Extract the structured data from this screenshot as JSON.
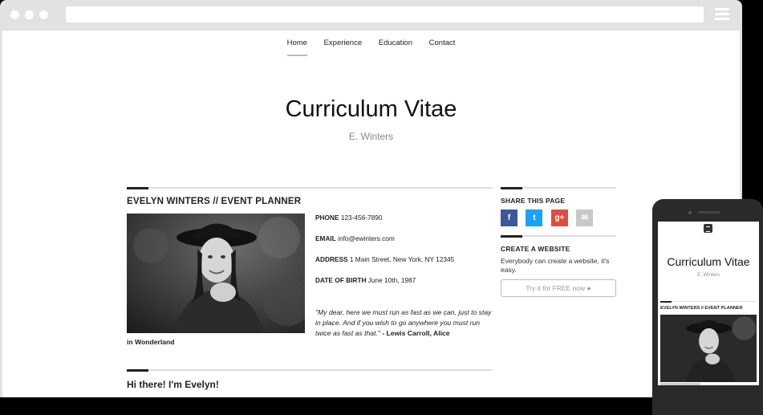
{
  "nav": {
    "items": [
      {
        "label": "Home"
      },
      {
        "label": "Experience"
      },
      {
        "label": "Education"
      },
      {
        "label": "Contact"
      }
    ]
  },
  "hero": {
    "title": "Curriculum Vitae",
    "subtitle": "E. Winters"
  },
  "profile": {
    "heading": "EVELYN WINTERS // EVENT PLANNER",
    "contact": [
      {
        "key": "PHONE",
        "value": "123-456-7890"
      },
      {
        "key": "EMAIL",
        "value": "info@ewinters.com"
      },
      {
        "key": "ADDRESS",
        "value": "1 Main Street, New York, NY 12345"
      },
      {
        "key": "DATE OF BIRTH",
        "value": "June 10th, 1987"
      }
    ],
    "quote": "\"My dear, here we must run as fast as we can, just to stay in place. And if you wish to go anywhere you must run twice as fast as that.\"",
    "quote_author": "- Lewis Carroll, Alice",
    "quote_tail": "in Wonderland",
    "greeting": "Hi there! I'm Evelyn!"
  },
  "sidebar": {
    "share_heading": "SHARE THIS PAGE",
    "share_icons": [
      "f",
      "t",
      "g+",
      "✉"
    ],
    "create_heading": "CREATE A WEBSITE",
    "create_text": "Everybody can create a website, it's easy.",
    "button_label": "Try it for FREE now"
  },
  "phone": {
    "title": "Curriculum Vitae",
    "subtitle": "E. Winters",
    "heading": "EVELYN WINTERS // EVENT PLANNER"
  },
  "colors": {
    "facebook": "#3b5998",
    "twitter": "#1da1f2",
    "google_plus": "#dc4e41",
    "email": "#c8c8c8"
  }
}
